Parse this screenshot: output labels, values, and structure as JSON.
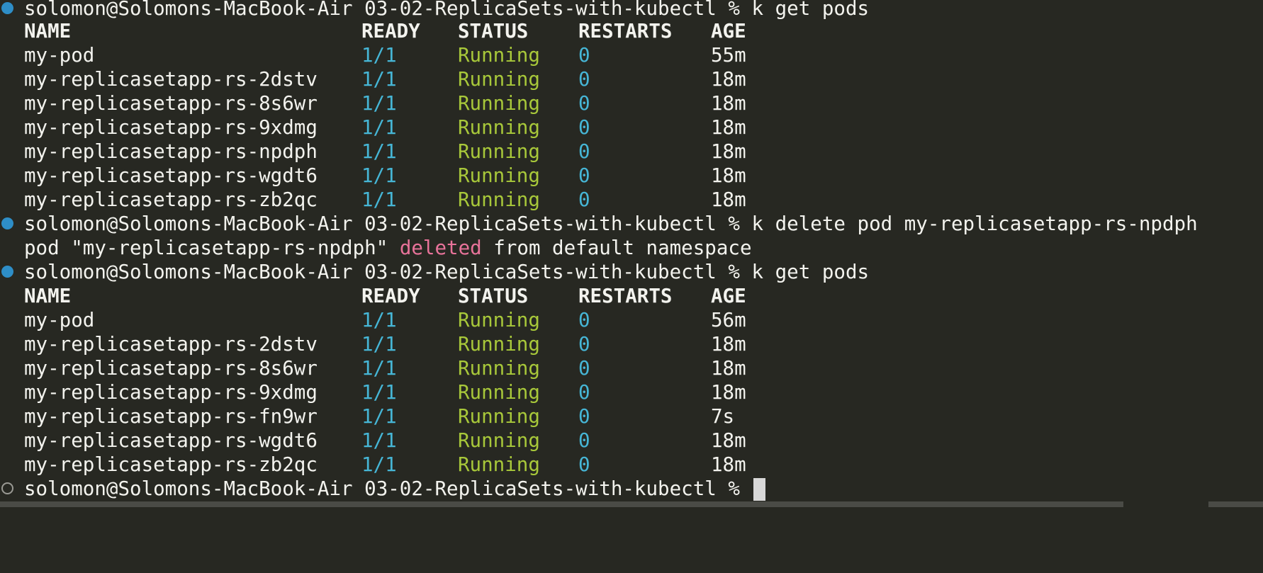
{
  "terminal": {
    "prompt": "solomon@Solomons-MacBook-Air 03-02-ReplicaSets-with-kubectl % ",
    "columns": {
      "name": "NAME",
      "ready": "READY",
      "status": "STATUS",
      "restarts": "RESTARTS",
      "age": "AGE"
    },
    "block1": {
      "command": "k get pods",
      "rows": [
        {
          "name": "my-pod",
          "ready": "1/1",
          "status": "Running",
          "restarts": "0",
          "age": "55m"
        },
        {
          "name": "my-replicasetapp-rs-2dstv",
          "ready": "1/1",
          "status": "Running",
          "restarts": "0",
          "age": "18m"
        },
        {
          "name": "my-replicasetapp-rs-8s6wr",
          "ready": "1/1",
          "status": "Running",
          "restarts": "0",
          "age": "18m"
        },
        {
          "name": "my-replicasetapp-rs-9xdmg",
          "ready": "1/1",
          "status": "Running",
          "restarts": "0",
          "age": "18m"
        },
        {
          "name": "my-replicasetapp-rs-npdph",
          "ready": "1/1",
          "status": "Running",
          "restarts": "0",
          "age": "18m"
        },
        {
          "name": "my-replicasetapp-rs-wgdt6",
          "ready": "1/1",
          "status": "Running",
          "restarts": "0",
          "age": "18m"
        },
        {
          "name": "my-replicasetapp-rs-zb2qc",
          "ready": "1/1",
          "status": "Running",
          "restarts": "0",
          "age": "18m"
        }
      ]
    },
    "block2": {
      "command": "k delete pod my-replicasetapp-rs-npdph",
      "output_before": "pod \"my-replicasetapp-rs-npdph\" ",
      "output_keyword": "deleted",
      "output_after": " from default namespace"
    },
    "block3": {
      "command": "k get pods",
      "rows": [
        {
          "name": "my-pod",
          "ready": "1/1",
          "status": "Running",
          "restarts": "0",
          "age": "56m"
        },
        {
          "name": "my-replicasetapp-rs-2dstv",
          "ready": "1/1",
          "status": "Running",
          "restarts": "0",
          "age": "18m"
        },
        {
          "name": "my-replicasetapp-rs-8s6wr",
          "ready": "1/1",
          "status": "Running",
          "restarts": "0",
          "age": "18m"
        },
        {
          "name": "my-replicasetapp-rs-9xdmg",
          "ready": "1/1",
          "status": "Running",
          "restarts": "0",
          "age": "18m"
        },
        {
          "name": "my-replicasetapp-rs-fn9wr",
          "ready": "1/1",
          "status": "Running",
          "restarts": "0",
          "age": "7s"
        },
        {
          "name": "my-replicasetapp-rs-wgdt6",
          "ready": "1/1",
          "status": "Running",
          "restarts": "0",
          "age": "18m"
        },
        {
          "name": "my-replicasetapp-rs-zb2qc",
          "ready": "1/1",
          "status": "Running",
          "restarts": "0",
          "age": "18m"
        }
      ]
    },
    "colors": {
      "background": "#272822",
      "text": "#f3f3ee",
      "ready_restarts": "#46b6d6",
      "status_running": "#a8c83a",
      "deleted_keyword": "#e8739a",
      "dot_success": "#2e8ec7"
    },
    "icons": {
      "command_success_marker": "filled-circle-icon",
      "pending_prompt_marker": "hollow-circle-icon",
      "cursor": "block-cursor"
    }
  }
}
